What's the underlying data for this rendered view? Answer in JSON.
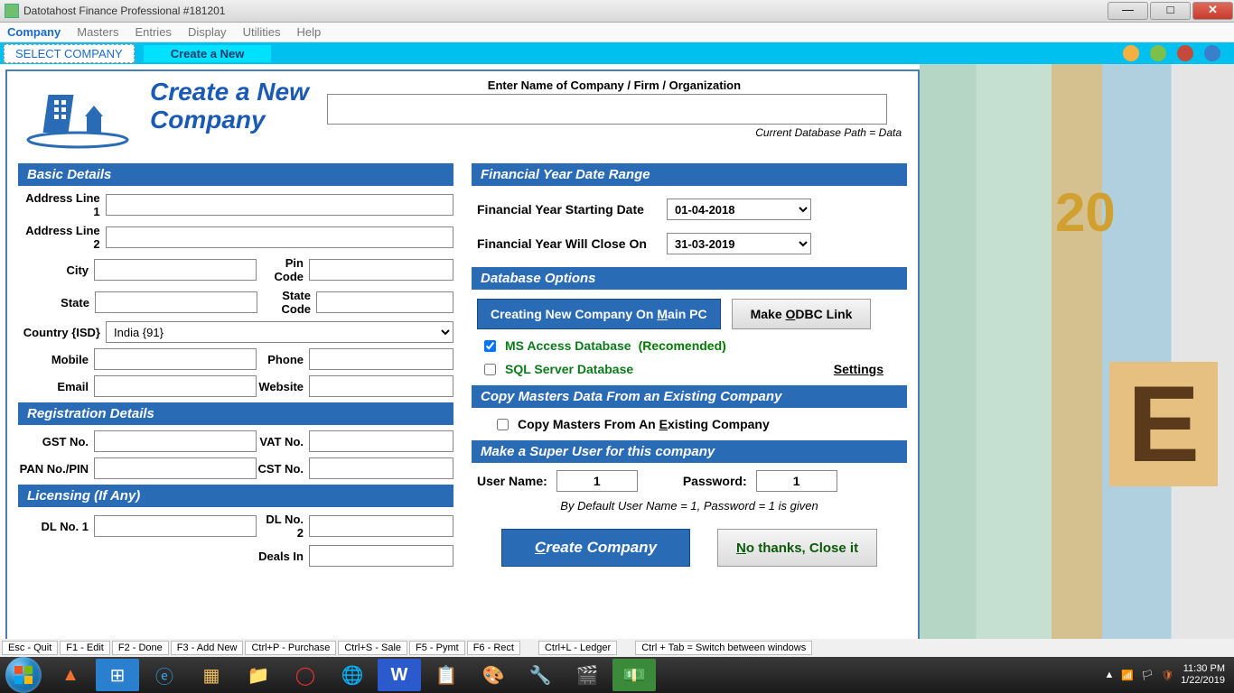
{
  "titlebar": {
    "title": "Datotahost Finance Professional #181201"
  },
  "menu": {
    "items": [
      "Company",
      "Masters",
      "Entries",
      "Display",
      "Utilities",
      "Help"
    ],
    "active": "Company"
  },
  "ribbon": {
    "tab1": "SELECT COMPANY",
    "tab2": "Create a New"
  },
  "header": {
    "title1": "Create a New",
    "title2": "Company",
    "nameLabel": "Enter Name of Company / Firm / Organization",
    "dbPath": "Current Database Path = Data"
  },
  "sections": {
    "basic": "Basic Details",
    "reg": "Registration Details",
    "lic": "Licensing (If Any)",
    "fy": "Financial Year Date Range",
    "dbopt": "Database Options",
    "copy": "Copy Masters Data From an Existing Company",
    "su": "Make a Super User for this company"
  },
  "labels": {
    "addr1": "Address Line 1",
    "addr2": "Address Line 2",
    "city": "City",
    "pin": "Pin Code",
    "state": "State",
    "stcode": "State Code",
    "country": "Country {ISD}",
    "countryVal": "India  {91}",
    "mobile": "Mobile",
    "phone": "Phone",
    "email": "Email",
    "website": "Website",
    "gst": "GST No.",
    "vat": "VAT No.",
    "pan": "PAN No./PIN",
    "cst": "CST No.",
    "dl1": "DL No. 1",
    "dl2": "DL No. 2",
    "deals": "Deals In",
    "fystart": "Financial Year Starting Date",
    "fyend": "Financial Year Will Close On",
    "fystartVal": "01-04-2018",
    "fyendVal": "31-03-2019",
    "btnNewMain": "Creating New Company On Main PC",
    "btnOdbc": "Make ODBC Link",
    "msaccess": "MS Access Database",
    "recomended": "(Recomended)",
    "sqlserver": "SQL Server Database",
    "settings": "Settings",
    "copyChk": "Copy Masters From An Existing Company",
    "suUser": "User Name:",
    "suPwd": "Password:",
    "suUserVal": "1",
    "suPwdVal": "1",
    "suNote": "By Default User Name = 1,  Password = 1 is given",
    "createBtn": "Create Company",
    "closeBtn": "No thanks, Close it"
  },
  "statusbar": [
    "Esc - Quit",
    "F1 - Edit",
    "F2 - Done",
    "F3 - Add New",
    "Ctrl+P - Purchase",
    "Ctrl+S - Sale",
    "F5 - Pymt",
    "F6 - Rect",
    "Ctrl+L - Ledger",
    "Ctrl + Tab = Switch between windows"
  ],
  "tray": {
    "time": "11:30 PM",
    "date": "1/22/2019"
  }
}
